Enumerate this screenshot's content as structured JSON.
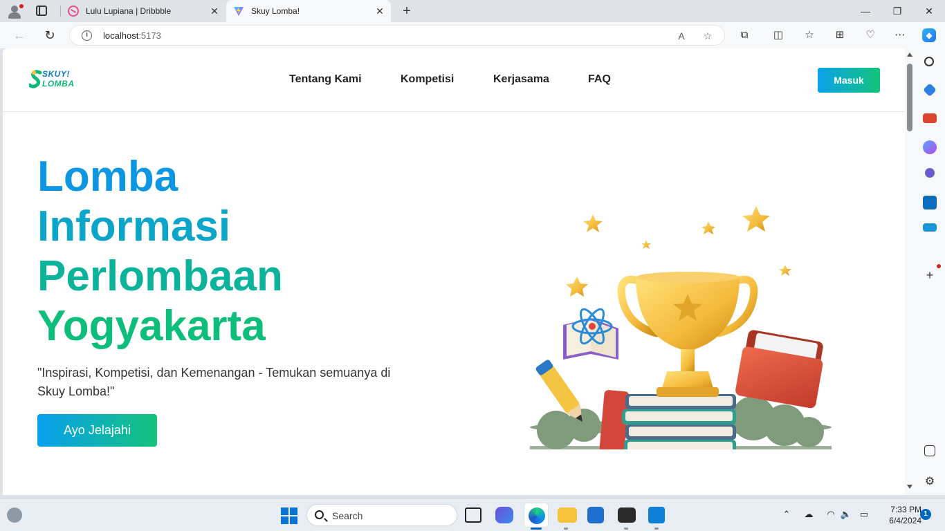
{
  "browser": {
    "tabs": [
      {
        "title": "Lulu Lupiana | Dribbble",
        "icon": "dribbble-icon",
        "active": false
      },
      {
        "title": "Skuy Lomba!",
        "icon": "vite-icon",
        "active": true
      }
    ],
    "url_host": "localhost",
    "url_port": ":5173"
  },
  "site": {
    "logo": {
      "line1": "SKUY!",
      "line2": "LOMBA"
    },
    "nav": [
      "Tentang Kami",
      "Kompetisi",
      "Kerjasama",
      "FAQ"
    ],
    "login_label": "Masuk",
    "hero": {
      "title_lines": [
        "Lomba",
        "Informasi",
        "Perlombaan",
        "Yogyakarta"
      ],
      "subtitle": "\"Inspirasi, Kompetisi, dan Kemenangan - Temukan semuanya di Skuy Lomba!\"",
      "cta_label": "Ayo Jelajahi",
      "illustration": "trophy-books-illustration"
    },
    "colors": {
      "brand_blue": "#0d97e3",
      "brand_green": "#0dbd7b"
    }
  },
  "taskbar": {
    "search_placeholder": "Search",
    "time": "7:33 PM",
    "date": "6/4/2024",
    "notification_count": "1"
  }
}
